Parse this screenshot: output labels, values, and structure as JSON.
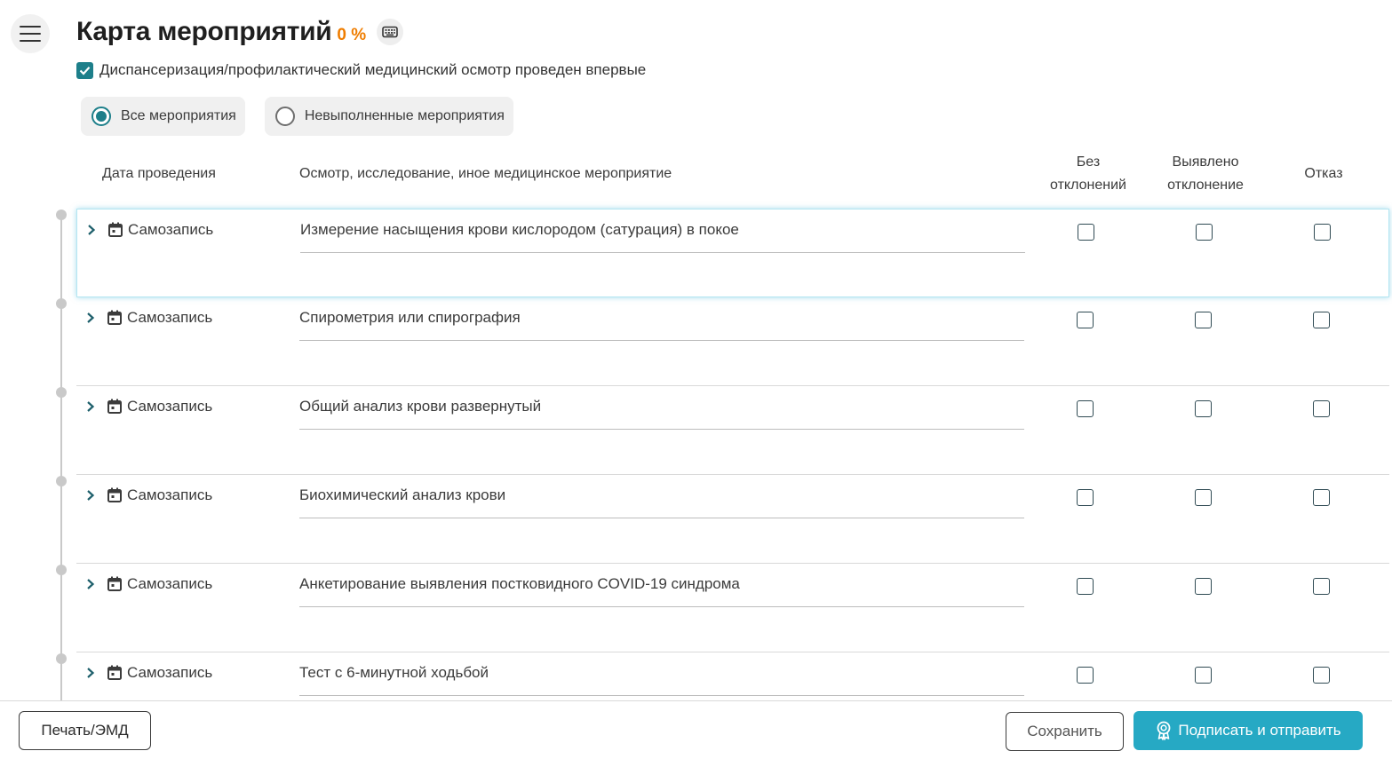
{
  "header": {
    "title": "Карта мероприятий",
    "percent": "0 %"
  },
  "first_time_checkbox": {
    "label": "Диспансеризация/профилактический медицинский осмотр проведен впервые",
    "checked": true
  },
  "filters": {
    "all": "Все мероприятия",
    "unfinished": "Невыполненные мероприятия",
    "selected": "all"
  },
  "table": {
    "columns": {
      "date": "Дата проведения",
      "event": "Осмотр, исследование, иное медицинское мероприятие",
      "no_deviation": "Без отклонений",
      "deviation": "Выявлено отклонение",
      "refusal": "Отказ"
    },
    "rows": [
      {
        "date": "Самозапись",
        "event": "Измерение насыщения крови кислородом (сатурация) в покое"
      },
      {
        "date": "Самозапись",
        "event": "Спирометрия или спирография"
      },
      {
        "date": "Самозапись",
        "event": "Общий анализ крови развернутый"
      },
      {
        "date": "Самозапись",
        "event": "Биохимический анализ крови"
      },
      {
        "date": "Самозапись",
        "event": "Анкетирование выявления постковидного COVID-19 синдрома"
      },
      {
        "date": "Самозапись",
        "event": "Тест с 6-минутной ходьбой"
      }
    ]
  },
  "footer": {
    "print_label": "Печать/ЭМД",
    "save_label": "Сохранить",
    "sign_label": "Подписать и отправить"
  },
  "colors": {
    "accent": "#1d7f8a",
    "primary_button": "#26a9c4",
    "percent": "#ef7d00"
  }
}
